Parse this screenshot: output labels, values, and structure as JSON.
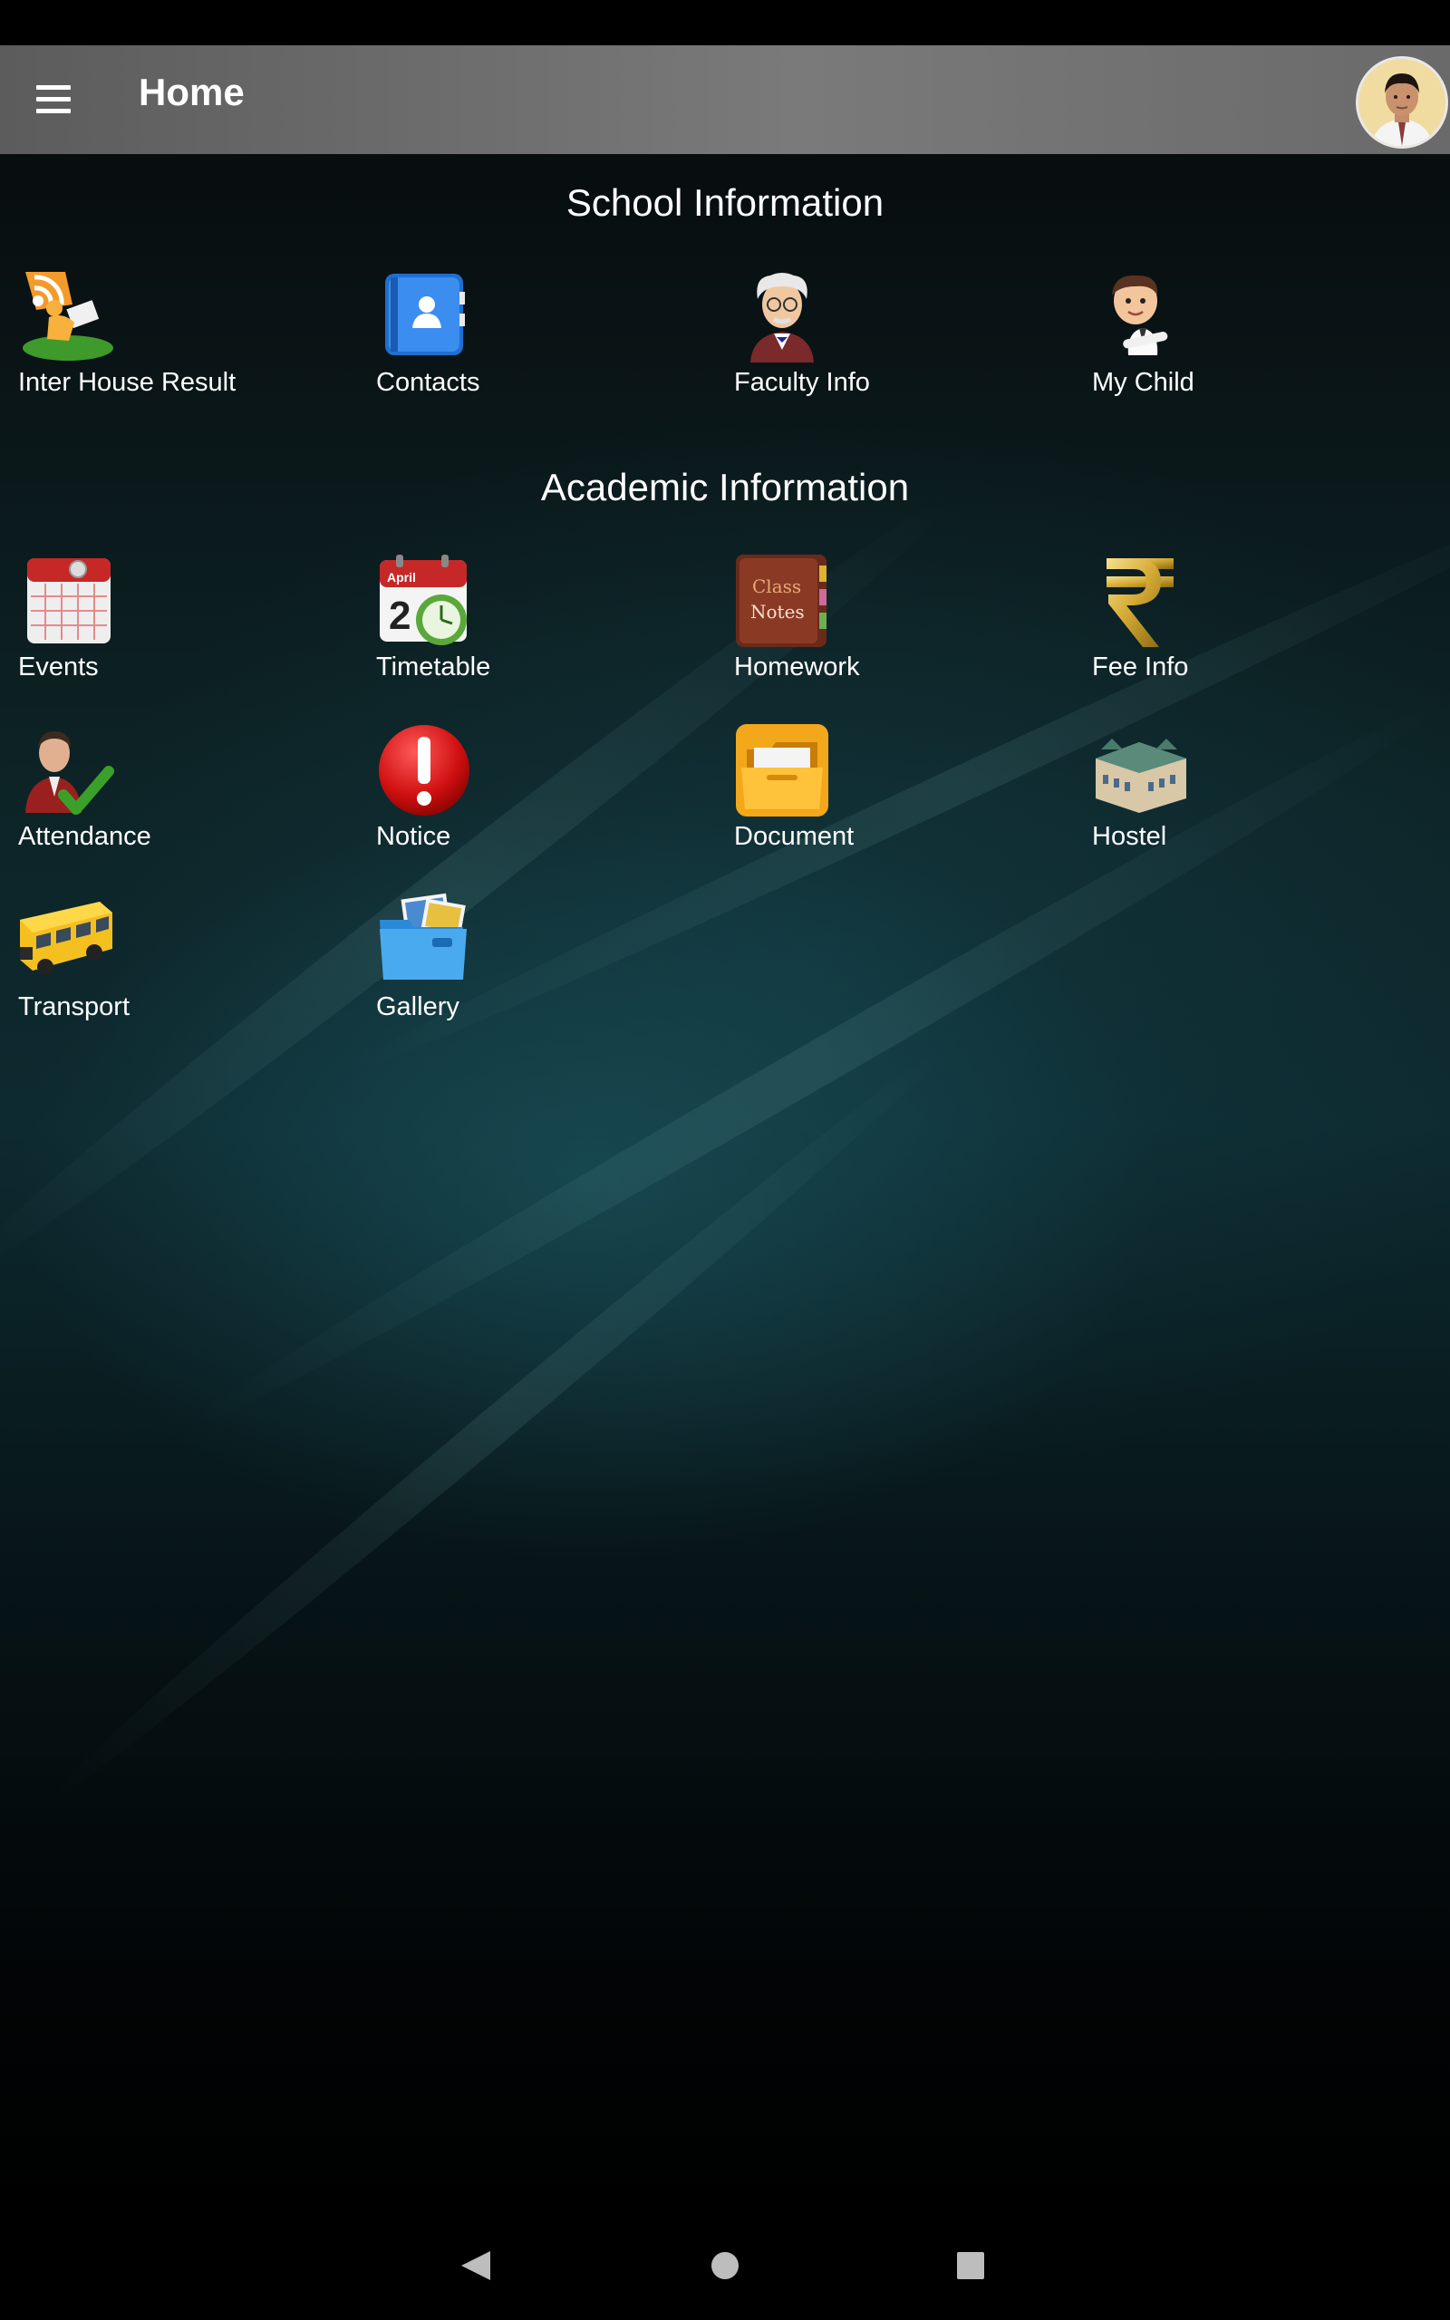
{
  "header": {
    "title": "Home",
    "menu_icon": "hamburger-menu-icon",
    "avatar_icon": "user-avatar"
  },
  "sections": [
    {
      "title": "School Information",
      "items": [
        {
          "label": "Inter House Result",
          "icon": "rss-reader-icon"
        },
        {
          "label": "Contacts",
          "icon": "contacts-book-icon"
        },
        {
          "label": "Faculty Info",
          "icon": "professor-icon"
        },
        {
          "label": "My Child",
          "icon": "child-icon"
        }
      ]
    },
    {
      "title": "Academic Information",
      "items": [
        {
          "label": "Events",
          "icon": "calendar-icon"
        },
        {
          "label": "Timetable",
          "icon": "calendar-clock-icon",
          "icon_text": [
            "April",
            "2"
          ]
        },
        {
          "label": "Homework",
          "icon": "class-notes-book-icon",
          "icon_text": [
            "Class",
            "Notes"
          ]
        },
        {
          "label": "Fee Info",
          "icon": "rupee-icon"
        },
        {
          "label": "Attendance",
          "icon": "person-check-icon"
        },
        {
          "label": "Notice",
          "icon": "exclamation-icon"
        },
        {
          "label": "Document",
          "icon": "folder-icon"
        },
        {
          "label": "Hostel",
          "icon": "building-icon"
        },
        {
          "label": "Transport",
          "icon": "school-bus-icon"
        },
        {
          "label": "Gallery",
          "icon": "photo-folder-icon"
        }
      ]
    }
  ],
  "navbar": {
    "back_icon": "back-triangle-icon",
    "home_icon": "home-circle-icon",
    "recents_icon": "recents-square-icon"
  },
  "colors": {
    "appbar": "#6f6f6f",
    "background_teal": "#0d2a30",
    "text": "#ffffff"
  }
}
